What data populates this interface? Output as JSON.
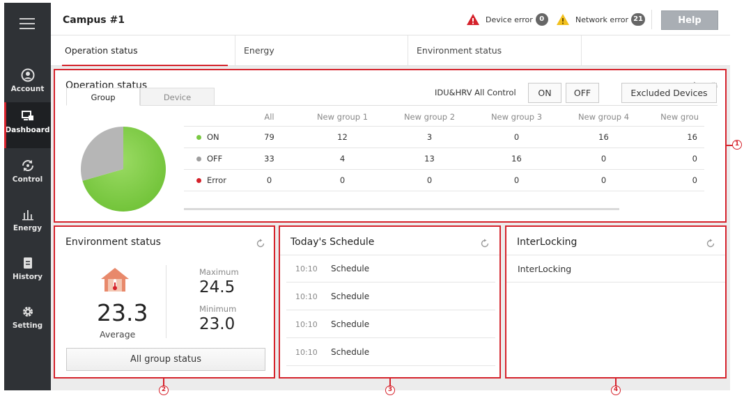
{
  "sidebar": {
    "items": [
      {
        "label": "Account",
        "icon": "account-icon"
      },
      {
        "label": "Dashboard",
        "icon": "dashboard-icon"
      },
      {
        "label": "Control",
        "icon": "control-icon"
      },
      {
        "label": "Energy",
        "icon": "energy-icon"
      },
      {
        "label": "History",
        "icon": "history-icon"
      },
      {
        "label": "Setting",
        "icon": "gear-icon"
      }
    ]
  },
  "header": {
    "title": "Campus #1",
    "device_error_label": "Device error",
    "device_error_count": "0",
    "network_error_label": "Network error",
    "network_error_count": "21",
    "help_label": "Help"
  },
  "tabs": [
    {
      "label": "Operation status"
    },
    {
      "label": "Energy"
    },
    {
      "label": "Environment status"
    }
  ],
  "operation": {
    "title": "Operation status",
    "subtabs": [
      "Group",
      "Device"
    ],
    "control_label": "IDU&HRV All Control",
    "on_label": "ON",
    "off_label": "OFF",
    "excluded_label": "Excluded Devices",
    "columns": [
      "All",
      "New group 1",
      "New group 2",
      "New group 3",
      "New group 4",
      "New grou"
    ],
    "rows": [
      {
        "label": "ON",
        "color": "#7ac943",
        "values": [
          "79",
          "12",
          "3",
          "0",
          "16",
          "16"
        ]
      },
      {
        "label": "OFF",
        "color": "#9e9e9e",
        "values": [
          "33",
          "4",
          "13",
          "16",
          "0",
          "0"
        ]
      },
      {
        "label": "Error",
        "color": "#d5222b",
        "values": [
          "0",
          "0",
          "0",
          "0",
          "0",
          "0"
        ]
      }
    ],
    "pie": {
      "on": 79,
      "off": 33,
      "error": 0
    }
  },
  "environment": {
    "title": "Environment status",
    "average": "23.3",
    "average_label": "Average",
    "max_label": "Maximum",
    "max_value": "24.5",
    "min_label": "Minimum",
    "min_value": "23.0",
    "button_label": "All group status"
  },
  "schedule": {
    "title": "Today's Schedule",
    "items": [
      {
        "time": "10:10",
        "name": "Schedule"
      },
      {
        "time": "10:10",
        "name": "Schedule"
      },
      {
        "time": "10:10",
        "name": "Schedule"
      },
      {
        "time": "10:10",
        "name": "Schedule"
      }
    ]
  },
  "interlocking": {
    "title": "InterLocking",
    "items": [
      "InterLocking"
    ]
  },
  "callouts": [
    "1",
    "2",
    "3",
    "4"
  ],
  "colors": {
    "accent": "#d5222b",
    "on": "#7ac943",
    "off": "#9e9e9e",
    "sidebar": "#2f3236"
  }
}
